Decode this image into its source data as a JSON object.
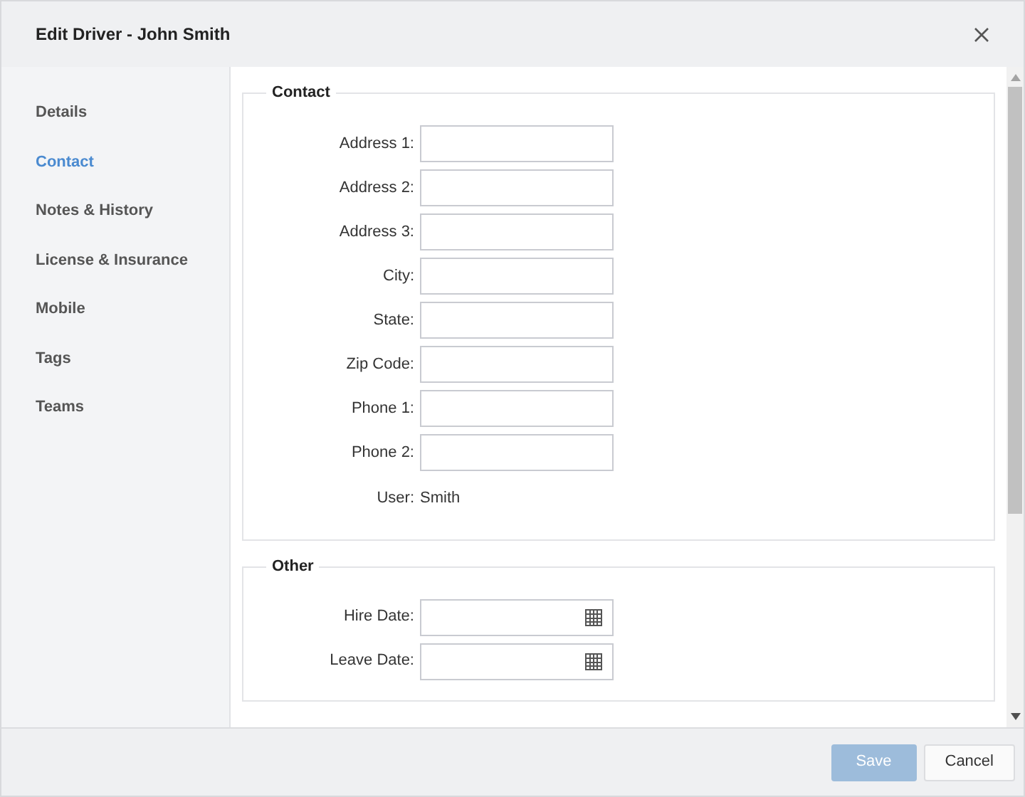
{
  "window": {
    "title": "Edit Driver - John Smith"
  },
  "sidebar": {
    "items": [
      {
        "label": "Details",
        "selected": false
      },
      {
        "label": "Contact",
        "selected": true
      },
      {
        "label": "Notes & History",
        "selected": false
      },
      {
        "label": "License & Insurance",
        "selected": false
      },
      {
        "label": "Mobile",
        "selected": false
      },
      {
        "label": "Tags",
        "selected": false
      },
      {
        "label": "Teams",
        "selected": false
      }
    ]
  },
  "sections": [
    {
      "title": "Contact",
      "fields": [
        {
          "label": "Address 1:",
          "kind": "text"
        },
        {
          "label": "Address 2:",
          "kind": "text"
        },
        {
          "label": "Address 3:",
          "kind": "text"
        },
        {
          "label": "City:",
          "kind": "text"
        },
        {
          "label": "State:",
          "kind": "text"
        },
        {
          "label": "Zip Code:",
          "kind": "text"
        },
        {
          "label": "Phone 1:",
          "kind": "text"
        },
        {
          "label": "Phone 2:",
          "kind": "text"
        },
        {
          "label": "User:",
          "kind": "static",
          "value": "Smith"
        }
      ]
    },
    {
      "title": "Other",
      "fields": [
        {
          "label": "Hire Date:",
          "kind": "date"
        },
        {
          "label": "Leave Date:",
          "kind": "date"
        }
      ]
    }
  ],
  "buttons": [
    {
      "label": "Save",
      "disabled": true
    },
    {
      "label": "Cancel",
      "disabled": false
    }
  ]
}
